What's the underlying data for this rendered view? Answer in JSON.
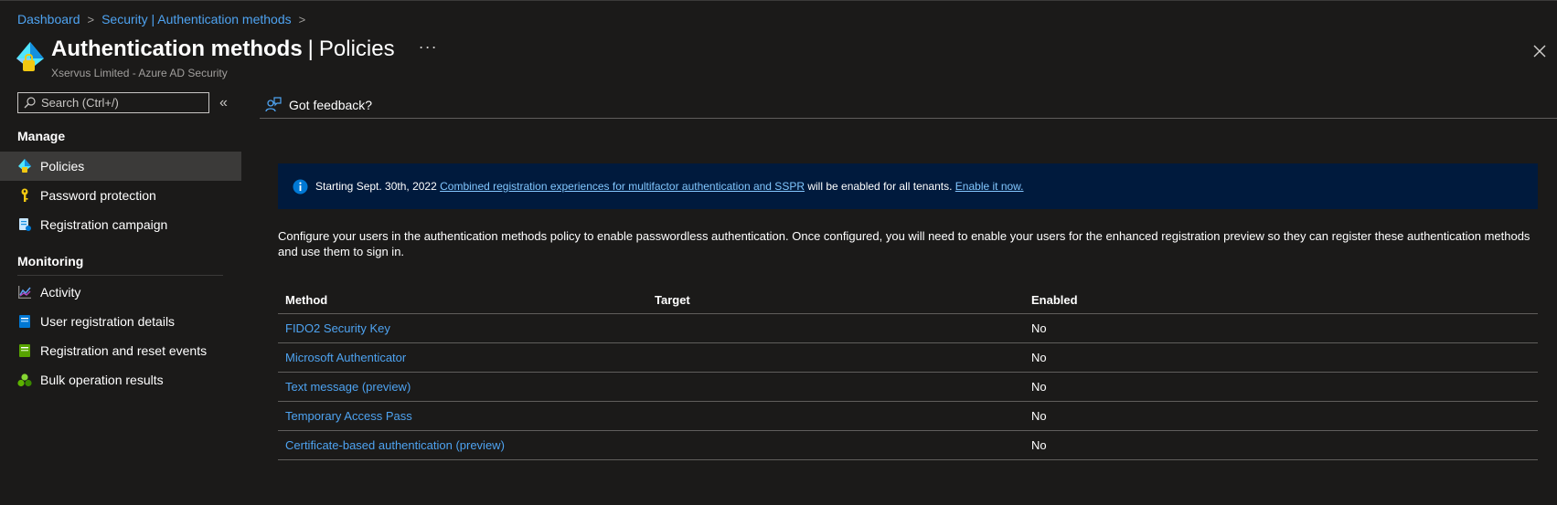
{
  "breadcrumb": [
    "Dashboard",
    "Security | Authentication methods"
  ],
  "header": {
    "title": "Authentication methods",
    "title_separator": "|",
    "title_suffix": "Policies",
    "more": "···",
    "subtitle": "Xservus Limited - Azure AD Security"
  },
  "sidebar": {
    "search_placeholder": "Search (Ctrl+/)",
    "collapse": "«",
    "sections": [
      {
        "title": "Manage",
        "items": [
          {
            "label": "Policies",
            "icon": "policy-diamond-icon",
            "active": true
          },
          {
            "label": "Password protection",
            "icon": "key-icon"
          },
          {
            "label": "Registration campaign",
            "icon": "registration-campaign-icon"
          }
        ]
      },
      {
        "title": "Monitoring",
        "items": [
          {
            "label": "Activity",
            "icon": "activity-chart-icon"
          },
          {
            "label": "User registration details",
            "icon": "user-details-icon"
          },
          {
            "label": "Registration and reset events",
            "icon": "events-log-icon"
          },
          {
            "label": "Bulk operation results",
            "icon": "bulk-results-icon"
          }
        ]
      }
    ]
  },
  "command_bar": {
    "feedback_label": "Got feedback?"
  },
  "banner": {
    "prefix": "Starting Sept. 30th, 2022",
    "link1": "Combined registration experiences for multifactor authentication and SSPR",
    "middle": "will be enabled for all tenants.",
    "link2": "Enable it now."
  },
  "description": "Configure your users in the authentication methods policy to enable passwordless authentication. Once configured, you will need to enable your users for the enhanced registration preview so they can register these authentication methods and use them to sign in.",
  "table": {
    "headers": [
      "Method",
      "Target",
      "Enabled"
    ],
    "rows": [
      {
        "method": "FIDO2 Security Key",
        "target": "",
        "enabled": "No"
      },
      {
        "method": "Microsoft Authenticator",
        "target": "",
        "enabled": "No"
      },
      {
        "method": "Text message (preview)",
        "target": "",
        "enabled": "No"
      },
      {
        "method": "Temporary Access Pass",
        "target": "",
        "enabled": "No"
      },
      {
        "method": "Certificate-based authentication (preview)",
        "target": "",
        "enabled": "No"
      }
    ]
  },
  "colors": {
    "background": "#1b1a19",
    "link": "#4ea3f1",
    "banner_bg": "#001a3d",
    "active_nav": "#3b3a39"
  }
}
